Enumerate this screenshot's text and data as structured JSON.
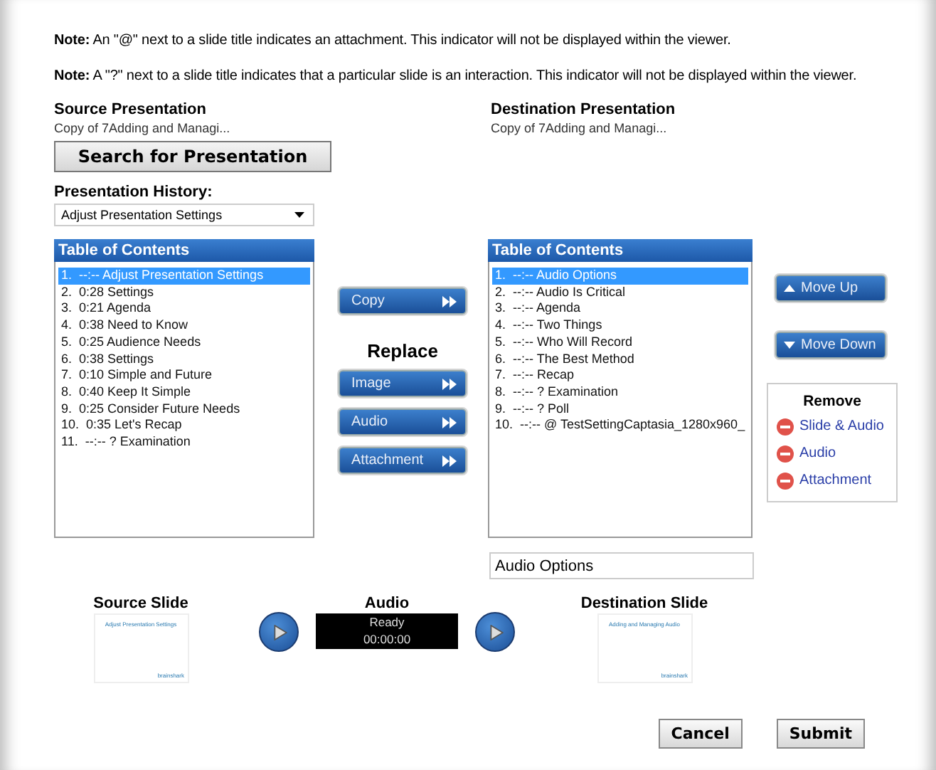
{
  "notes": [
    "**Note:** An \"@\" next to a slide title indicates an attachment. This indicator will not be displayed within the viewer.",
    "**Note:** A \"?\" next to a slide title indicates that a particular slide is an interaction. This indicator will not be displayed within the viewer."
  ],
  "source": {
    "label": "Source Presentation",
    "name": "Copy of 7Adding and Managi...",
    "search_button": "Search for Presentation",
    "history_label": "Presentation History:",
    "history_value": "Adjust Presentation Settings"
  },
  "destination": {
    "label": "Destination Presentation",
    "name": "Copy of 7Adding and Managi..."
  },
  "source_toc": {
    "title": "Table of Contents",
    "items": [
      {
        "number": "1.",
        "text": "--:-- Adjust Presentation Settings",
        "selected": true
      },
      {
        "number": "2.",
        "text": "0:28 Settings",
        "selected": false
      },
      {
        "number": "3.",
        "text": "0:21 Agenda",
        "selected": false
      },
      {
        "number": "4.",
        "text": "0:38 Need to Know",
        "selected": false
      },
      {
        "number": "5.",
        "text": "0:25 Audience Needs",
        "selected": false
      },
      {
        "number": "6.",
        "text": "0:38 Settings",
        "selected": false
      },
      {
        "number": "7.",
        "text": "0:10 Simple and Future",
        "selected": false
      },
      {
        "number": "8.",
        "text": "0:40 Keep It Simple",
        "selected": false
      },
      {
        "number": "9.",
        "text": "0:25 Consider Future Needs",
        "selected": false
      },
      {
        "number": "10.",
        "text": "0:35 Let's Recap",
        "selected": false
      },
      {
        "number": "11.",
        "text": "--:-- ? Examination",
        "selected": false
      }
    ]
  },
  "copy_button": "Copy",
  "replace": {
    "label": "Replace",
    "buttons": [
      "Image",
      "Audio",
      "Attachment"
    ]
  },
  "destination_toc": {
    "title": "Table of Contents",
    "items": [
      {
        "number": "1.",
        "text": "--:-- Audio Options",
        "selected": true
      },
      {
        "number": "2.",
        "text": "--:-- Audio Is Critical",
        "selected": false
      },
      {
        "number": "3.",
        "text": "--:-- Agenda",
        "selected": false
      },
      {
        "number": "4.",
        "text": "--:-- Two Things",
        "selected": false
      },
      {
        "number": "5.",
        "text": "--:-- Who Will Record",
        "selected": false
      },
      {
        "number": "6.",
        "text": "--:-- The Best Method",
        "selected": false
      },
      {
        "number": "7.",
        "text": "--:-- Recap",
        "selected": false
      },
      {
        "number": "8.",
        "text": "--:-- ? Examination",
        "selected": false
      },
      {
        "number": "9.",
        "text": "--:-- ? Poll",
        "selected": false
      },
      {
        "number": "10.",
        "text": "--:-- @ TestSettingCaptasia_1280x960_",
        "selected": false
      }
    ]
  },
  "move_buttons": [
    {
      "kind": "up",
      "label": "Move Up"
    },
    {
      "kind": "down",
      "label": "Move Down"
    }
  ],
  "remove": {
    "title": "Remove",
    "items": [
      "Slide & Audio",
      "Audio",
      "Attachment"
    ]
  },
  "slide_title_field": "Audio Options",
  "source_slide": {
    "label": "Source Slide",
    "thumbnail_title": "Adjust Presentation Settings",
    "logo": "brainshark"
  },
  "audio": {
    "label": "Audio",
    "status": "Ready",
    "time": "00:00:00"
  },
  "destination_slide": {
    "label": "Destination Slide",
    "thumbnail_title": "Adding and Managing Audio",
    "logo": "brainshark"
  },
  "buttons": [
    "Cancel",
    "Submit"
  ]
}
